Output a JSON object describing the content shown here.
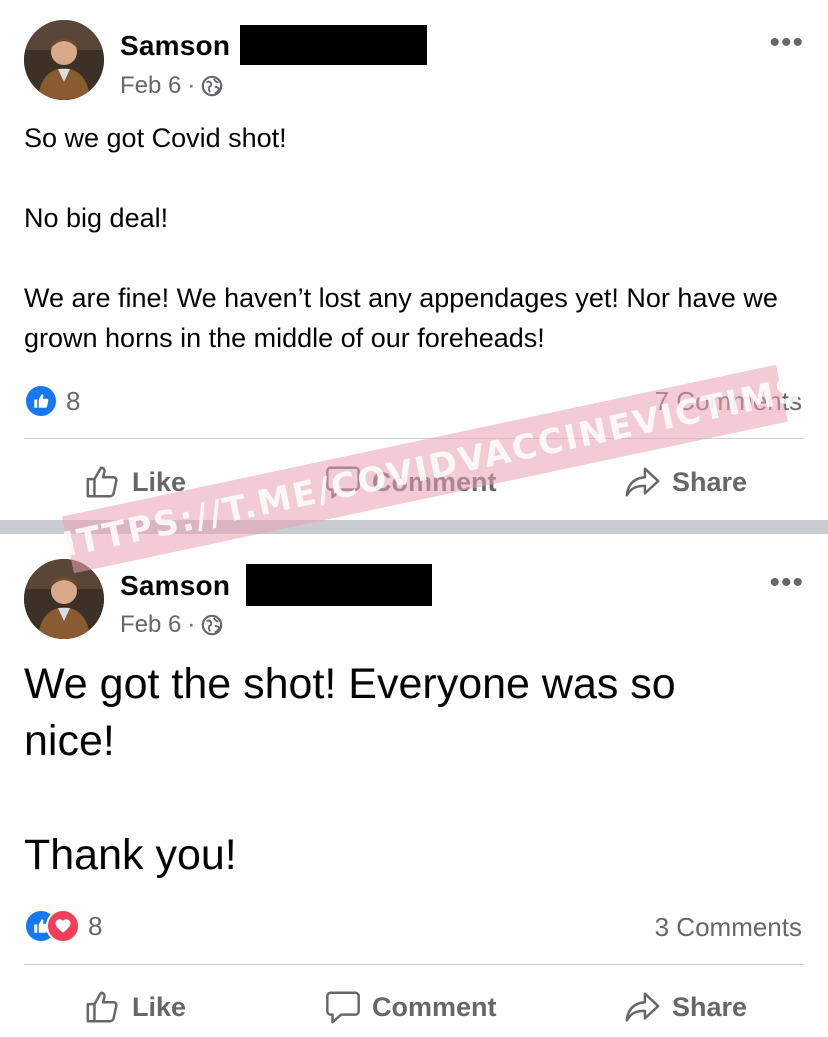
{
  "posts": [
    {
      "author": "Samson",
      "date": "Feb 6",
      "dot": "·",
      "audience_icon": "globe-icon",
      "more_label": "•••",
      "paragraphs": [
        "So we got Covid shot!",
        "No big deal!",
        "We are fine!  We haven’t lost any appendages yet!  Nor have we grown horns in the middle of our foreheads!"
      ],
      "reaction_icons": [
        "like-reaction-icon"
      ],
      "reaction_count": "8",
      "comments": "7 Comments",
      "actions": {
        "like": "Like",
        "comment": "Comment",
        "share": "Share"
      }
    },
    {
      "author": "Samson",
      "date": "Feb 6",
      "dot": "·",
      "audience_icon": "globe-icon",
      "more_label": "•••",
      "paragraphs": [
        "We got the shot!  Everyone was so nice!",
        "Thank you!"
      ],
      "reaction_icons": [
        "like-reaction-icon",
        "love-reaction-icon"
      ],
      "reaction_count": "8",
      "comments": "3 Comments",
      "actions": {
        "like": "Like",
        "comment": "Comment",
        "share": "Share"
      }
    }
  ],
  "watermark": "HTTPS://T.ME/COVIDVACCINEVICTIMS",
  "colors": {
    "text": "#050505",
    "muted": "#65676b",
    "like_blue": "#1877f2",
    "love_red": "#f33e58",
    "separator": "#c9ccd1",
    "watermark": "#e8a0b2"
  }
}
